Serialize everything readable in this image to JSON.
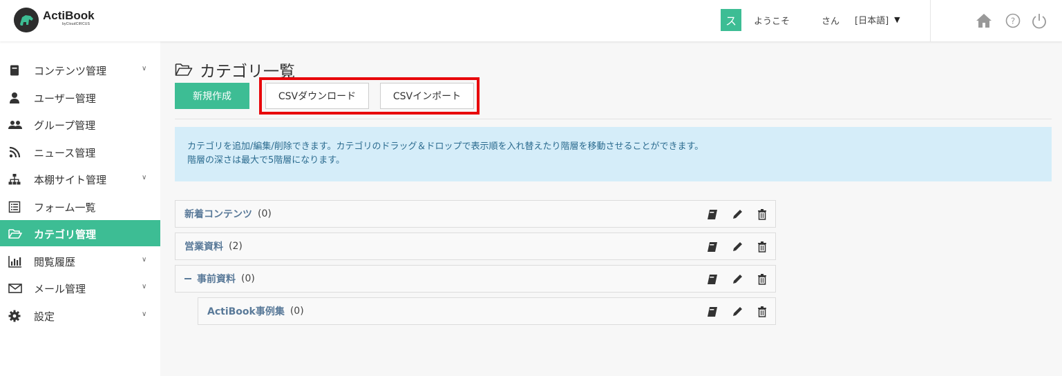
{
  "header": {
    "app_name": "ActiBook",
    "app_sub": "byCloudCIRCUS",
    "avatar_initial": "ス",
    "welcome": "ようこそ",
    "honorific": "さん",
    "language": "[日本語]",
    "icons": [
      "home-icon",
      "help-icon",
      "power-icon"
    ]
  },
  "sidebar": {
    "accent_color": "#3dbd94",
    "items": [
      {
        "label": "コンテンツ管理",
        "icon": "book-icon",
        "expandable": true
      },
      {
        "label": "ユーザー管理",
        "icon": "user-icon",
        "expandable": false
      },
      {
        "label": "グループ管理",
        "icon": "group-icon",
        "expandable": false
      },
      {
        "label": "ニュース管理",
        "icon": "rss-icon",
        "expandable": false
      },
      {
        "label": "本棚サイト管理",
        "icon": "sitemap-icon",
        "expandable": true
      },
      {
        "label": "フォーム一覧",
        "icon": "form-icon",
        "expandable": false
      },
      {
        "label": "カテゴリ管理",
        "icon": "folder-icon",
        "expandable": false,
        "active": true
      },
      {
        "label": "閲覧履歴",
        "icon": "bar-chart-icon",
        "expandable": true
      },
      {
        "label": "メール管理",
        "icon": "envelope-icon",
        "expandable": true
      },
      {
        "label": "設定",
        "icon": "gear-icon",
        "expandable": true
      }
    ]
  },
  "main": {
    "title": "カテゴリ一覧",
    "buttons": {
      "create": "新規作成",
      "csv_download": "CSVダウンロード",
      "csv_import": "CSVインポート"
    },
    "info_lines": [
      "カテゴリを追加/編集/削除できます。カテゴリのドラッグ＆ドロップで表示順を入れ替えたり階層を移動させることができます。",
      "階層の深さは最大で5階層になります。"
    ],
    "categories": [
      {
        "name": "新着コンテンツ",
        "count": "(0)",
        "level": 0,
        "collapsible": false
      },
      {
        "name": "営業資料",
        "count": "(2)",
        "level": 0,
        "collapsible": false
      },
      {
        "name": "事前資料",
        "count": "(0)",
        "level": 0,
        "collapsible": true
      },
      {
        "name": "ActiBook事例集",
        "count": "(0)",
        "level": 1,
        "collapsible": false
      }
    ],
    "row_actions": [
      "contents-icon",
      "edit-icon",
      "delete-icon"
    ]
  }
}
